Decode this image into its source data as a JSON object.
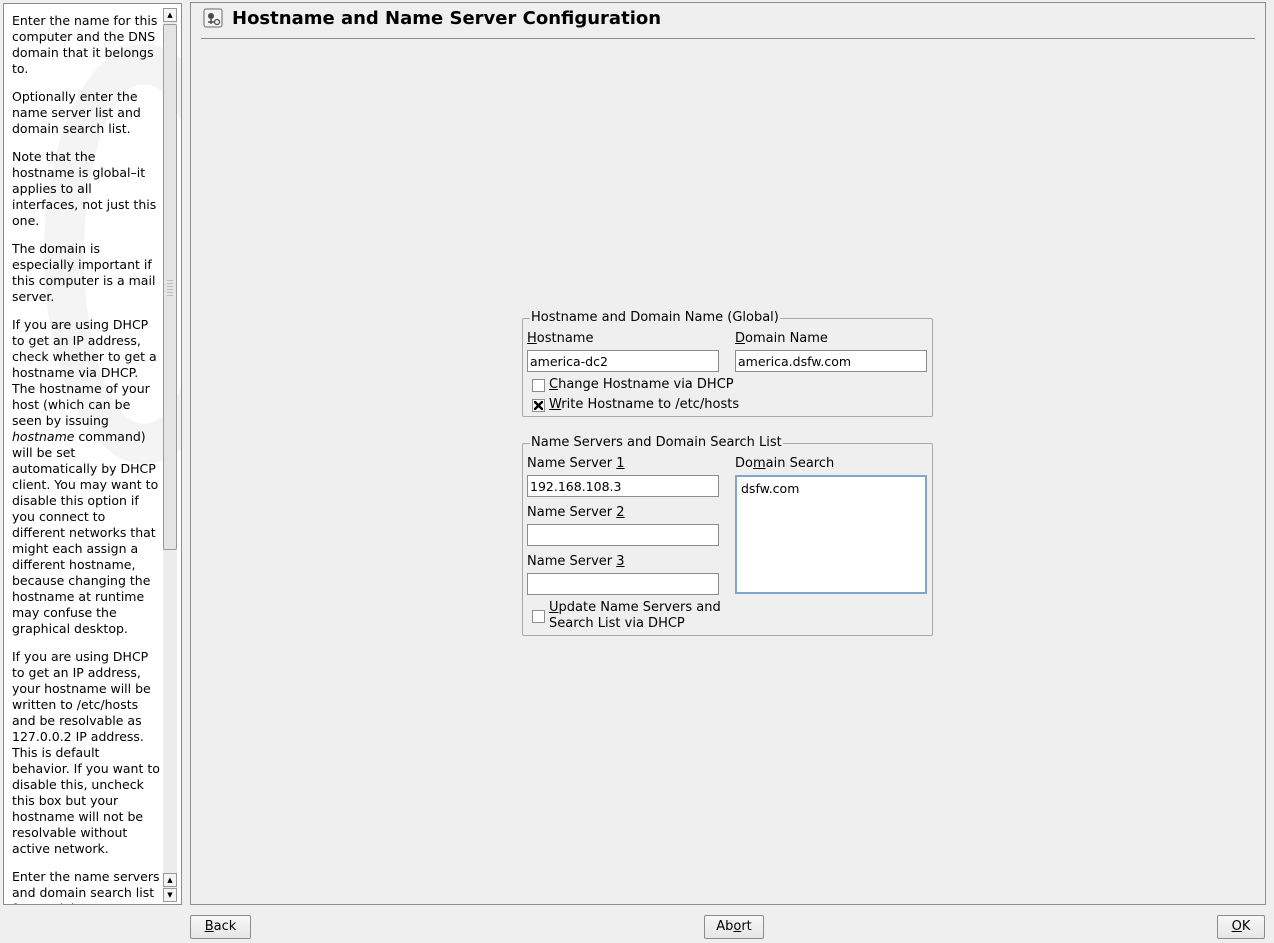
{
  "help": {
    "paragraphs": [
      "Enter the name for this computer and the DNS domain that it belongs to.",
      "Optionally enter the name server list and domain search list.",
      "Note that the hostname is global–it applies to all interfaces, not just this one.",
      "The domain is especially important if this computer is a mail server."
    ],
    "dhcp_para_before": "If you are using DHCP to get an IP address, check whether to get a hostname via DHCP. The hostname of your host (which can be seen by issuing ",
    "dhcp_para_em": "hostname",
    "dhcp_para_after": " command) will be set automatically by DHCP client. You may want to disable this option if you connect to different networks that might each assign a different hostname, because changing the hostname at runtime may confuse the graphical desktop.",
    "hosts_para": "If you are using DHCP to get an IP address, your hostname will be written to /etc/hosts and be resolvable as 127.0.0.2 IP address. This is default behavior. If you want to disable this, uncheck this box but your hostname will not be resolvable without active network.",
    "ns_para": "Enter the name servers and domain search list for resolving hostnames. Usually they can be obtained by DHCP."
  },
  "header": {
    "title": "Hostname and Name Server Configuration"
  },
  "hostname_group": {
    "legend": "Hostname and Domain Name (Global)",
    "hostname_label_key": "H",
    "hostname_label_rest": "ostname",
    "hostname_value": "america-dc2",
    "domain_label_key": "D",
    "domain_label_rest": "omain Name",
    "domain_value": "america.dsfw.com",
    "change_dhcp_key": "C",
    "change_dhcp_rest": "hange Hostname via DHCP",
    "change_dhcp_checked": false,
    "write_hosts_key": "W",
    "write_hosts_rest": "rite Hostname to /etc/hosts",
    "write_hosts_checked": true
  },
  "ns_group": {
    "legend": "Name Servers and Domain Search List",
    "ns1_label_pre": "Name Server ",
    "ns1_label_key": "1",
    "ns1_value": "192.168.108.3",
    "ns2_label_pre": "Name Server ",
    "ns2_label_key": "2",
    "ns2_value": "",
    "ns3_label_pre": "Name Server ",
    "ns3_label_key": "3",
    "ns3_value": "",
    "search_label_pre": "Do",
    "search_label_key": "m",
    "search_label_rest": "ain Search",
    "search_value": "dsfw.com",
    "update_key": "U",
    "update_rest": "pdate Name Servers and",
    "update_line2": "Search List via DHCP",
    "update_checked": false
  },
  "buttons": {
    "back_key": "B",
    "back_rest": "ack",
    "abort_pre": "Ab",
    "abort_key": "o",
    "abort_rest": "rt",
    "ok_key": "O",
    "ok_rest": "K"
  },
  "icons": {
    "title_icon": "network-settings-icon"
  }
}
